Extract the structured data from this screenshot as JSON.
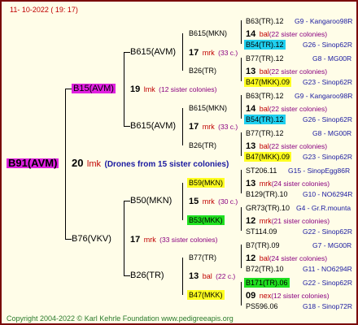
{
  "date": "11- 10-2022 ( 19: 17)",
  "footer": "Copyright 2004-2022 © Karl Kehrle Foundation    www.pedigreeapis.org",
  "colors": {
    "magenta": "#e020e0",
    "cyan": "#20d0f0",
    "yellow": "#ffff20",
    "green": "#20e020"
  },
  "root": {
    "name": "B91(AVM)",
    "num": "20",
    "unit": "lmk",
    "note": "(Drones from 15 sister colonies)"
  },
  "g1": [
    {
      "name": "B15(AVM)",
      "num": "19",
      "unit": "lmk",
      "note": "(12 sister colonies)"
    },
    {
      "name": "B76(VKV)",
      "num": "17",
      "unit": "mrk",
      "note": "(33 sister colonies)"
    }
  ],
  "g2": [
    {
      "name": "B615(AVM)",
      "num": "17",
      "unit": "mrk",
      "note": "(33 c.)"
    },
    {
      "name": "B615(AVM)",
      "num": "17",
      "unit": "mrk",
      "note": "(33 c.)"
    },
    {
      "name": "B50(MKN)",
      "num": "15",
      "unit": "mrk",
      "note": "(30 c.)"
    },
    {
      "name": "B26(TR)",
      "num": "13",
      "unit": "bal",
      "note": "(22 c.)"
    }
  ],
  "g3": [
    {
      "name": "B615(MKN)",
      "num": "14",
      "unit": "bal",
      "note": "(22 sister colonies)"
    },
    {
      "name": "B26(TR)",
      "num": "13",
      "unit": "bal",
      "note": "(22 sister colonies)"
    },
    {
      "name": "B615(MKN)",
      "num": "14",
      "unit": "bal",
      "note": "(22 sister colonies)"
    },
    {
      "name": "B26(TR)",
      "num": "13",
      "unit": "bal",
      "note": "(22 sister colonies)"
    },
    {
      "name": "B59(MKN)",
      "num": "13",
      "unit": "mrk",
      "note": "(24 sister colonies)"
    },
    {
      "name": "B53(MKK)",
      "num": "12",
      "unit": "mrk",
      "note": "(21 sister colonies)"
    },
    {
      "name": "B77(TR)",
      "num": "12",
      "unit": "bal",
      "note": "(24 sister colonies)"
    },
    {
      "name": "B47(MKK)",
      "num": "09",
      "unit": "nex",
      "note": "(12 sister colonies)"
    }
  ],
  "g4": [
    {
      "name": "B63(TR).12",
      "code": "G9 - Kangaroo98R"
    },
    {
      "name": "B54(TR).12",
      "code": "G26 - Sinop62R"
    },
    {
      "name": "B77(TR).12",
      "code": "G8 - MG00R"
    },
    {
      "name": "B47(MKK).09",
      "code": "G23 - Sinop62R"
    },
    {
      "name": "B63(TR).12",
      "code": "G9 - Kangaroo98R"
    },
    {
      "name": "B54(TR).12",
      "code": "G26 - Sinop62R"
    },
    {
      "name": "B77(TR).12",
      "code": "G8 - MG00R"
    },
    {
      "name": "B47(MKK).09",
      "code": "G23 - Sinop62R"
    },
    {
      "name": "ST206.11",
      "code": "G15 - SinopEgg86R"
    },
    {
      "name": "B129(TR).10",
      "code": "G10 - NO6294R"
    },
    {
      "name": "GR73(TR).10",
      "code": "G4 - Gr.R.mounta"
    },
    {
      "name": "ST114.09",
      "code": "G22 - Sinop62R"
    },
    {
      "name": "B7(TR).09",
      "code": "G7 - MG00R"
    },
    {
      "name": "B72(TR).10",
      "code": "G11 - NO6294R"
    },
    {
      "name": "B171(TR).06",
      "code": "G22 - Sinop62R"
    },
    {
      "name": "PS596.06",
      "code": "G18 - Sinop72R"
    }
  ]
}
